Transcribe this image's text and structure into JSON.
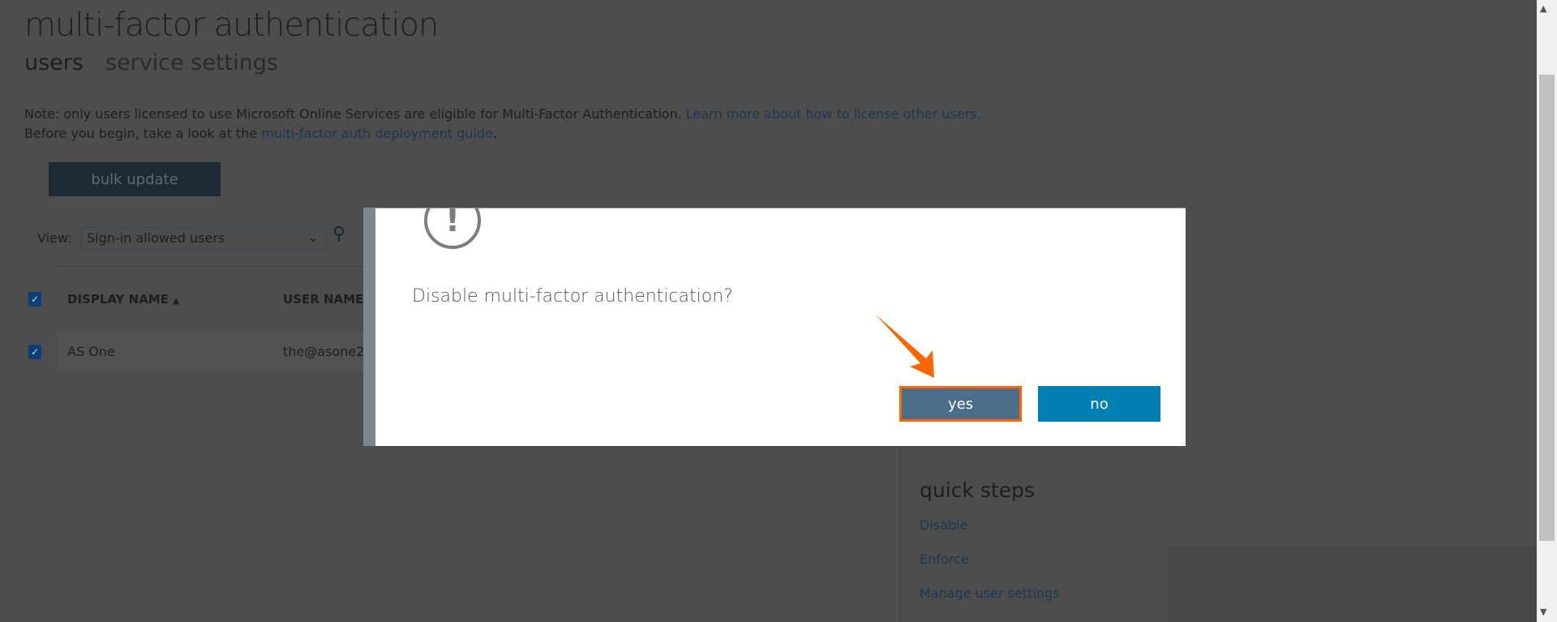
{
  "page": {
    "title": "multi-factor authentication",
    "tabs": [
      {
        "label": "users",
        "active": true
      },
      {
        "label": "service settings",
        "active": false
      }
    ]
  },
  "note": {
    "line1_text": "Note: only users licensed to use Microsoft Online Services are eligible for Multi-Factor Authentication. ",
    "line1_link": "Learn more about how to license other users.",
    "line2_text": "Before you begin, take a look at the ",
    "line2_link": "multi-factor auth deployment guide",
    "line2_end": "."
  },
  "toolbar": {
    "bulk_update": "bulk update",
    "view_label": "View:",
    "view_value": "Sign-in allowed users"
  },
  "table": {
    "headers": [
      "DISPLAY NAME",
      "USER NAME"
    ],
    "sort_indicator": "▲",
    "rows": [
      {
        "display_name": "AS One",
        "user_name": "the@asone2",
        "checked": true
      }
    ]
  },
  "dialog": {
    "icon": "exclamation-circle-icon",
    "question": "Disable multi-factor authentication?",
    "yes": "yes",
    "no": "no"
  },
  "quick_steps": {
    "title": "quick steps",
    "links": [
      "Disable",
      "Enforce",
      "Manage user settings"
    ]
  },
  "colors": {
    "accent": "#0080b2",
    "highlight": "#ff6600",
    "overlay": "#4d4d4d"
  }
}
